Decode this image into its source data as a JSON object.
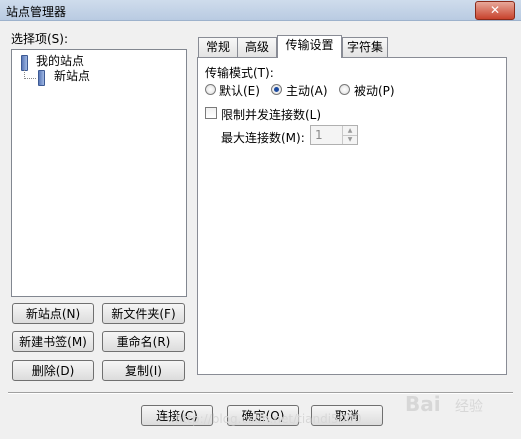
{
  "window": {
    "title": "站点管理器",
    "close_glyph": "✕"
  },
  "left": {
    "select_label": "选择项(S):",
    "tree": {
      "root": "我的站点",
      "child": "新站点"
    },
    "buttons": {
      "new_site": "新站点(N)",
      "new_folder": "新文件夹(F)",
      "new_bookmark": "新建书签(M)",
      "rename": "重命名(R)",
      "delete": "删除(D)",
      "copy": "复制(I)"
    }
  },
  "tabs": [
    "常规",
    "高级",
    "传输设置",
    "字符集"
  ],
  "active_tab": "传输设置",
  "transfer": {
    "mode_label": "传输模式(T):",
    "modes": [
      {
        "label": "默认(E)",
        "selected": false
      },
      {
        "label": "主动(A)",
        "selected": true
      },
      {
        "label": "被动(P)",
        "selected": false
      }
    ],
    "limit_label": "限制并发连接数(L)",
    "limit_checked": false,
    "max_conn_label": "最大连接数(M):",
    "max_conn_value": "1"
  },
  "footer": {
    "connect": "连接(C)",
    "ok": "确定(O)",
    "cancel": "取消"
  },
  "watermark": {
    "brand": "Bai",
    "brand2": "经验",
    "url": "http://blog.csdn.net/tiandi5000"
  }
}
